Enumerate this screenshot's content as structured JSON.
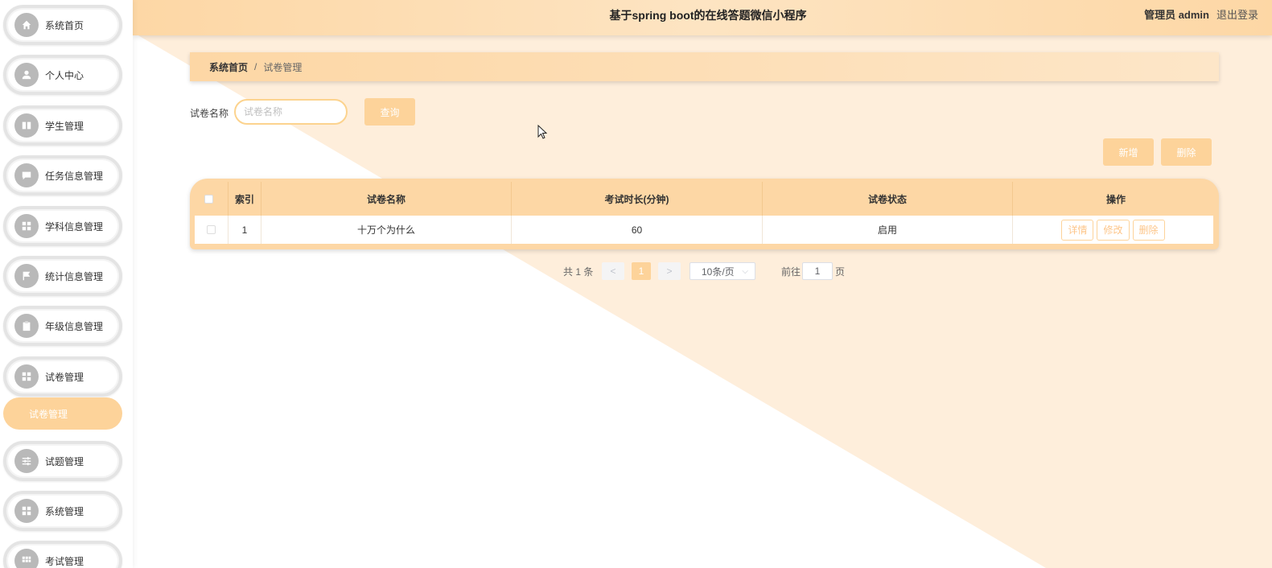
{
  "header": {
    "title": "基于spring boot的在线答题微信小程序",
    "user": "管理员 admin",
    "logout": "退出登录"
  },
  "sidebar": {
    "items": [
      {
        "label": "系统首页",
        "icon": "home-icon"
      },
      {
        "label": "个人中心",
        "icon": "user-icon"
      },
      {
        "label": "学生管理",
        "icon": "book-icon"
      },
      {
        "label": "任务信息管理",
        "icon": "message-icon"
      },
      {
        "label": "学科信息管理",
        "icon": "grid-icon"
      },
      {
        "label": "统计信息管理",
        "icon": "flag-icon"
      },
      {
        "label": "年级信息管理",
        "icon": "clipboard-icon"
      },
      {
        "label": "试卷管理",
        "icon": "grid-icon"
      },
      {
        "label": "试题管理",
        "icon": "sliders-icon"
      },
      {
        "label": "系统管理",
        "icon": "grid-icon"
      },
      {
        "label": "考试管理",
        "icon": "table-icon"
      }
    ],
    "submenu_active": "试卷管理"
  },
  "breadcrumb": {
    "home": "系统首页",
    "separator": "/",
    "current": "试卷管理"
  },
  "search": {
    "label": "试卷名称",
    "placeholder": "试卷名称",
    "button": "查询"
  },
  "actions": {
    "add": "新增",
    "delete": "删除"
  },
  "table": {
    "columns": [
      "索引",
      "试卷名称",
      "考试时长(分钟)",
      "试卷状态",
      "操作"
    ],
    "rows": [
      {
        "index": "1",
        "name": "十万个为什么",
        "duration": "60",
        "status": "启用"
      }
    ],
    "row_actions": [
      "详情",
      "修改",
      "删除"
    ]
  },
  "pagination": {
    "total": "共 1 条",
    "prev": "<",
    "current_page": "1",
    "next": ">",
    "page_size": "10条/页",
    "goto_label": "前往",
    "goto_value": "1",
    "page_suffix": "页"
  },
  "colors": {
    "accent": "#fdd39a",
    "header_bg": "#fdd7a5",
    "deco": "#fdebd3"
  }
}
